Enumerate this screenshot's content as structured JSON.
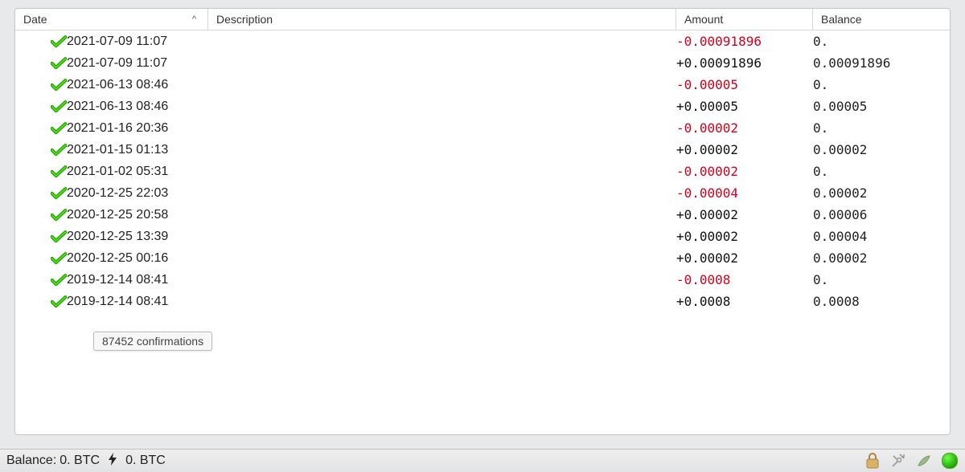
{
  "columns": {
    "date": "Date",
    "description": "Description",
    "amount": "Amount",
    "balance": "Balance"
  },
  "sort_indicator": "^",
  "transactions": [
    {
      "date": "2021-07-09 11:07",
      "desc": "",
      "amount": "-0.00091896",
      "neg": true,
      "balance": "0."
    },
    {
      "date": "2021-07-09 11:07",
      "desc": "",
      "amount": "+0.00091896",
      "neg": false,
      "balance": "0.00091896"
    },
    {
      "date": "2021-06-13 08:46",
      "desc": "",
      "amount": "-0.00005",
      "neg": true,
      "balance": "0."
    },
    {
      "date": "2021-06-13 08:46",
      "desc": "",
      "amount": "+0.00005",
      "neg": false,
      "balance": "0.00005"
    },
    {
      "date": "2021-01-16 20:36",
      "desc": "",
      "amount": "-0.00002",
      "neg": true,
      "balance": "0."
    },
    {
      "date": "2021-01-15 01:13",
      "desc": "",
      "amount": "+0.00002",
      "neg": false,
      "balance": "0.00002"
    },
    {
      "date": "2021-01-02 05:31",
      "desc": "",
      "amount": "-0.00002",
      "neg": true,
      "balance": "0."
    },
    {
      "date": "2020-12-25 22:03",
      "desc": "",
      "amount": "-0.00004",
      "neg": true,
      "balance": "0.00002"
    },
    {
      "date": "2020-12-25 20:58",
      "desc": "",
      "amount": "+0.00002",
      "neg": false,
      "balance": "0.00006"
    },
    {
      "date": "2020-12-25 13:39",
      "desc": "",
      "amount": "+0.00002",
      "neg": false,
      "balance": "0.00004"
    },
    {
      "date": "2020-12-25 00:16",
      "desc": "",
      "amount": "+0.00002",
      "neg": false,
      "balance": "0.00002"
    },
    {
      "date": "2019-12-14 08:41",
      "desc": "",
      "amount": "-0.0008",
      "neg": true,
      "balance": "0."
    },
    {
      "date": "2019-12-14 08:41",
      "desc": "",
      "amount": "+0.0008",
      "neg": false,
      "balance": "0.0008"
    }
  ],
  "tooltip": "87452 confirmations",
  "status": {
    "balance_label": "Balance:",
    "balance_value": "0. BTC",
    "lightning_value": "0. BTC"
  },
  "icons": {
    "confirmed": "confirmed",
    "lightning": "⚡",
    "lock": "lock",
    "tools": "tools",
    "seed": "seed",
    "net": "connected"
  }
}
